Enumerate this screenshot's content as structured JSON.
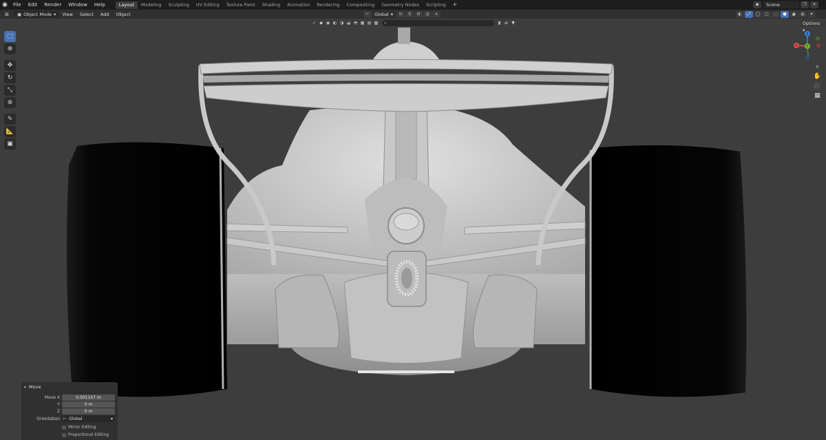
{
  "topbar": {
    "menus": [
      "File",
      "Edit",
      "Render",
      "Window",
      "Help"
    ],
    "workspaces": [
      "Layout",
      "Modeling",
      "Sculpting",
      "UV Editing",
      "Texture Paint",
      "Shading",
      "Animation",
      "Rendering",
      "Compositing",
      "Geometry Nodes",
      "Scripting"
    ],
    "active_workspace": "Layout",
    "add_tab": "+",
    "scene_value": "Scene"
  },
  "header": {
    "mode": "Object Mode",
    "menus": [
      "View",
      "Select",
      "Add",
      "Object"
    ],
    "orientation": "Global",
    "options_label": "Options"
  },
  "gizmo": {
    "x": "X",
    "y": "Y",
    "z": "Z"
  },
  "move_panel": {
    "title": "Move",
    "move_x_label": "Move X",
    "move_x_value": "0.001147 m",
    "y_label": "Y",
    "y_value": "0 m",
    "z_label": "Z",
    "z_value": "0 m",
    "orientation_label": "Orientation",
    "orientation_value": "Global",
    "mirror_label": "Mirror Editing",
    "proportional_label": "Proportional Editing"
  },
  "colors": {
    "accent": "#4772b3",
    "viewport_bg": "#3d3d3d",
    "topbar_bg": "#1d1d1d",
    "header_bg": "#303030",
    "axis_x": "#e0504f",
    "axis_y": "#6fb42b",
    "axis_z": "#3b84d8"
  }
}
